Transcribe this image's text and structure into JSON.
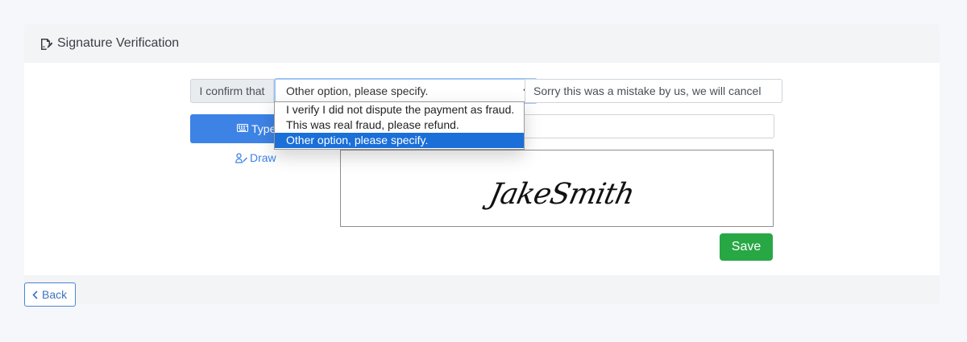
{
  "header": {
    "title": "Signature Verification",
    "icon": "signature-edit-icon"
  },
  "form": {
    "confirm_label": "I confirm that",
    "select_value": "Other option, please specify.",
    "other_text": "Sorry this was a mistake by us, we will cancel",
    "options": [
      "I verify I did not dispute the payment as fraud.",
      "This was real fraud, please refund.",
      "Other option, please specify."
    ],
    "selected_option_index": 2
  },
  "tabs": {
    "type_label": "Type",
    "draw_label": "Draw",
    "active": "Type"
  },
  "signature": {
    "text": "JakeSmith"
  },
  "buttons": {
    "save": "Save",
    "back": "Back"
  },
  "colors": {
    "primary": "#3d83e6",
    "success": "#28a745",
    "selected_option": "#1a6fd8",
    "page_bg": "#f5f7fa"
  }
}
